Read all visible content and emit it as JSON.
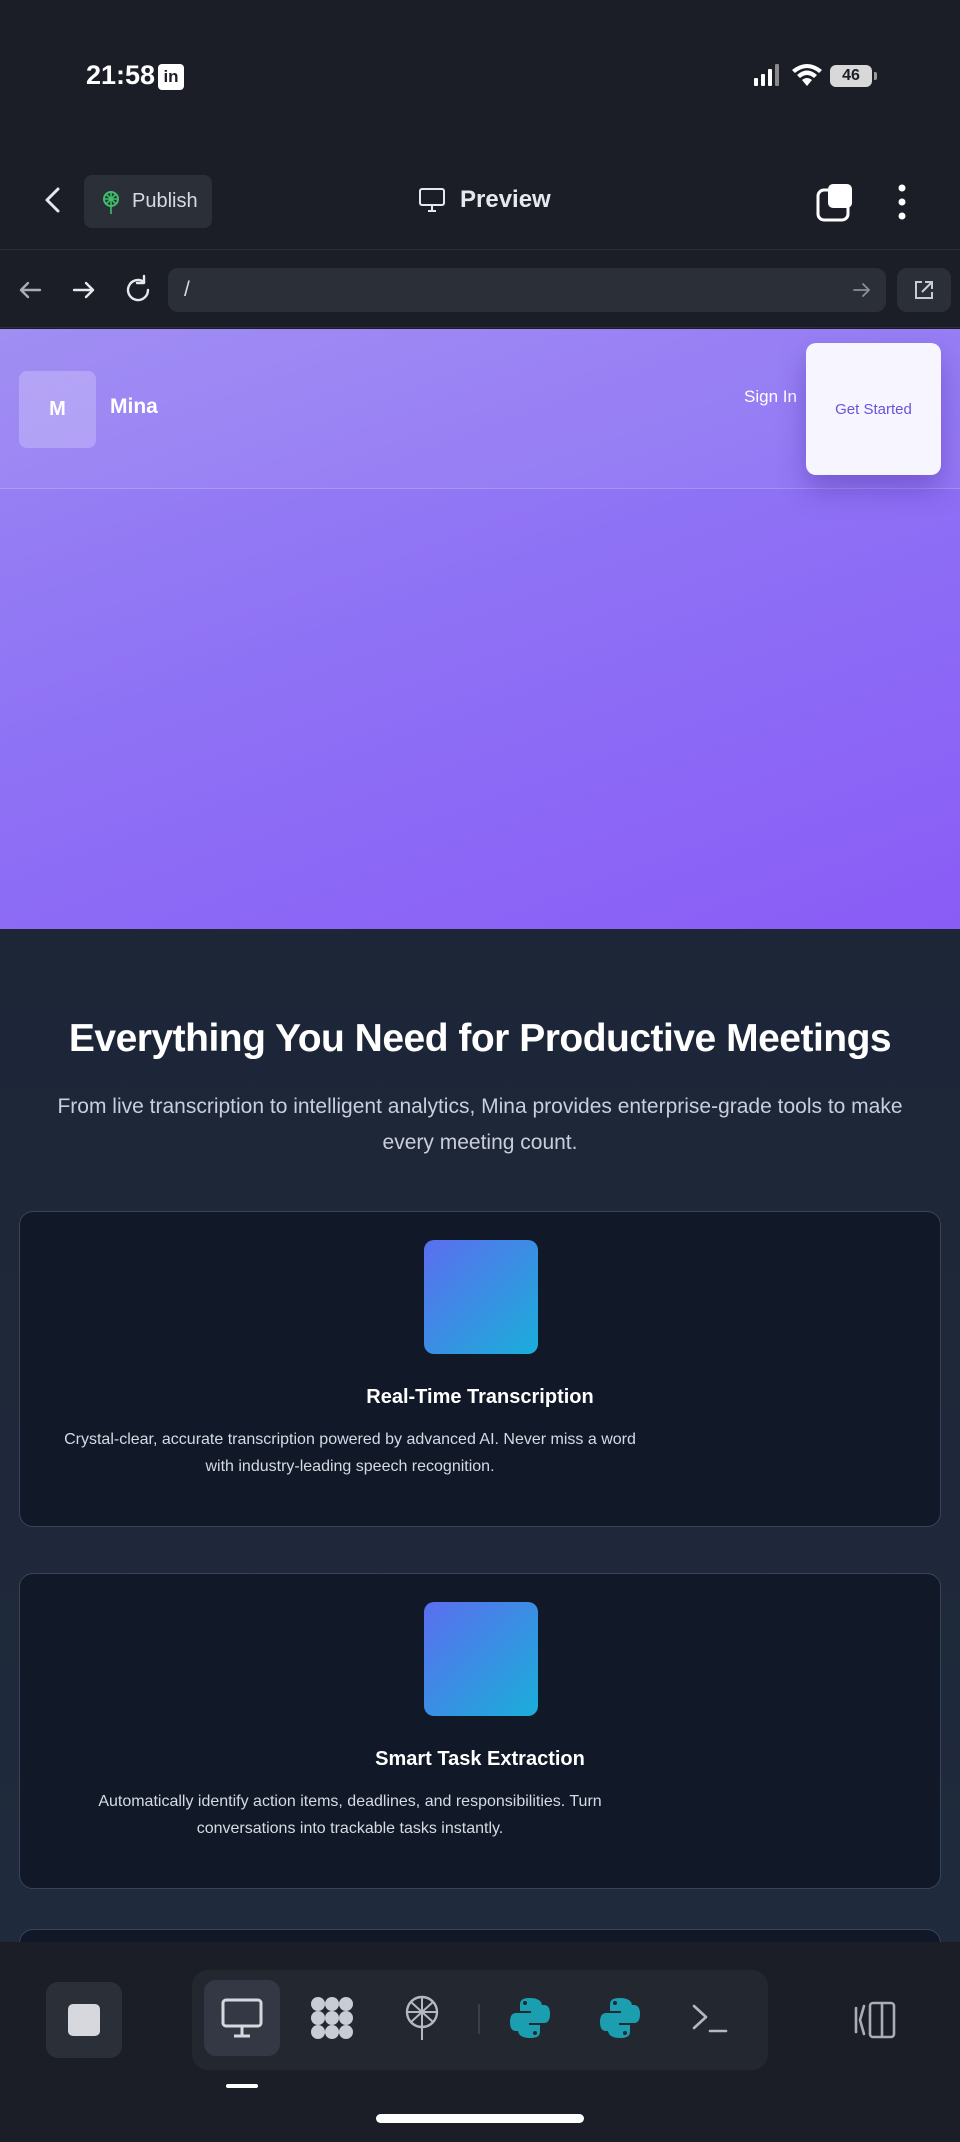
{
  "status_bar": {
    "time": "21:58",
    "notification_app": "in",
    "battery": "46"
  },
  "app_header": {
    "publish_label": "Publish",
    "preview_label": "Preview"
  },
  "url_bar": {
    "url": "/"
  },
  "site": {
    "logo_letter": "M",
    "brand": "Mina",
    "sign_in": "Sign In",
    "get_started": "Get Started"
  },
  "features": {
    "title": "Everything You Need for Productive Meetings",
    "subtitle": "From live transcription to intelligent analytics, Mina provides enterprise-grade tools to make every meeting count.",
    "cards": [
      {
        "title": "Real-Time Transcription",
        "description": "Crystal-clear, accurate transcription powered by advanced AI. Never miss a word with industry-leading speech recognition."
      },
      {
        "title": "Smart Task Extraction",
        "description": "Automatically identify action items, deadlines, and responsibilities. Turn conversations into trackable tasks instantly."
      }
    ]
  },
  "colors": {
    "hero_start": "#9b87f3",
    "hero_end": "#8a5cf6",
    "card_bg": "#111827",
    "icon_gradient_start": "#5b6ef0",
    "icon_gradient_end": "#1aaed8",
    "publish_icon": "#3fbf6a",
    "python_icon": "#1b9fb0"
  },
  "dock": {
    "items": [
      "desktop-icon",
      "grid-dots-icon",
      "deploy-icon",
      "python-icon",
      "python-icon",
      "terminal-icon"
    ]
  }
}
